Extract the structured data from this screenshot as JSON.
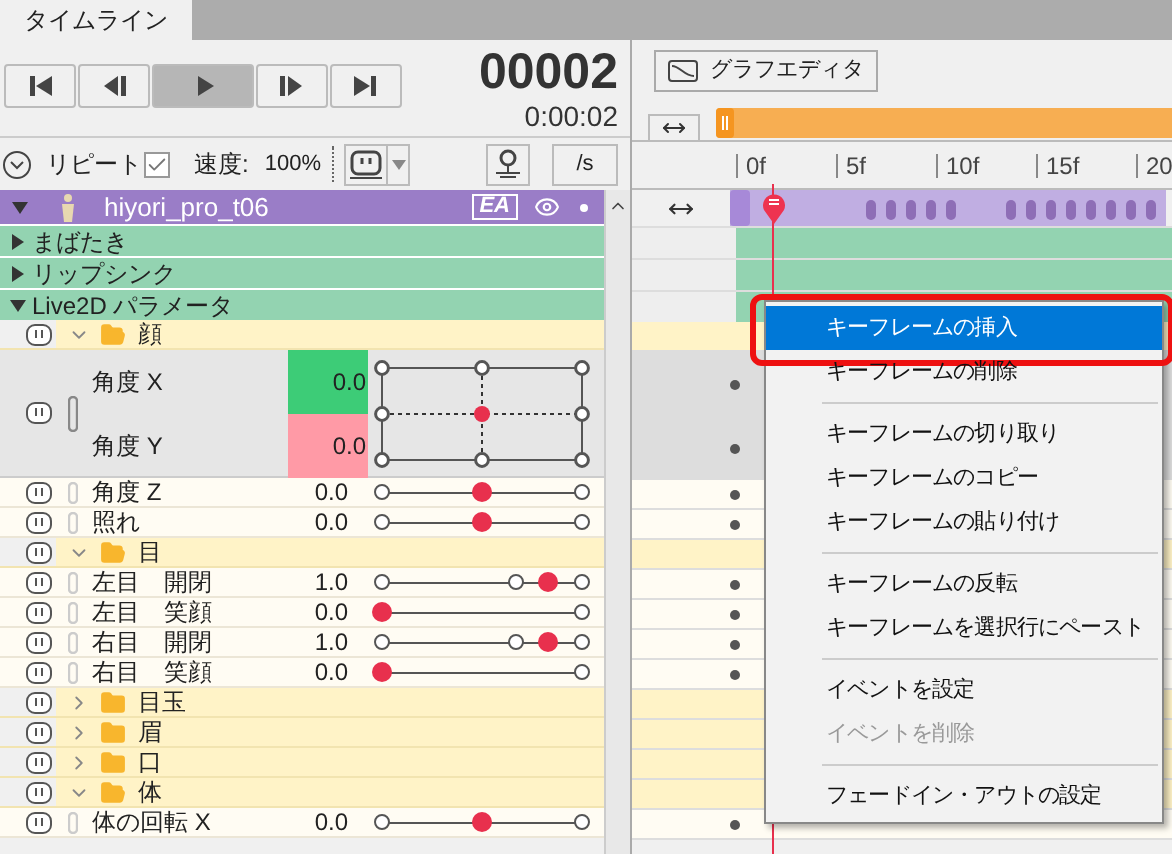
{
  "tabs": [
    {
      "label": "タイムライン",
      "selected": true
    }
  ],
  "transport": {
    "buttons": [
      {
        "kind": "first",
        "selected": false
      },
      {
        "kind": "prev",
        "selected": false
      },
      {
        "kind": "play",
        "selected": true
      },
      {
        "kind": "next",
        "selected": false
      },
      {
        "kind": "last",
        "selected": false
      }
    ],
    "frame": "00002",
    "time": "0:00:02"
  },
  "options": {
    "repeat": {
      "label": "リピート",
      "checked": true
    },
    "speed_label": "速度:",
    "speed": "100%",
    "fps_button": "/s"
  },
  "model": {
    "name": "hiyori_pro_t06",
    "badge": "EA",
    "expanded": true
  },
  "tracks": [
    {
      "label": "まばたき",
      "expanded": false
    },
    {
      "label": "リップシンク",
      "expanded": false
    },
    {
      "label": "Live2D パラメータ",
      "expanded": true
    }
  ],
  "parameters": [
    {
      "kind": "folder",
      "label": "顔",
      "expanded": true,
      "children": [
        {
          "kind": "group",
          "rows": [
            {
              "label": "角度 X",
              "value": "0.0",
              "color": "#3dcc77"
            },
            {
              "label": "角度 Y",
              "value": "0.0",
              "color": "#ff9aa6"
            }
          ]
        },
        {
          "kind": "centered",
          "label": "角度 Z",
          "value": "0.0",
          "level": 0.5
        },
        {
          "kind": "centered",
          "label": "照れ",
          "value": "0.0",
          "level": 0.5
        }
      ]
    },
    {
      "kind": "folder",
      "label": "目",
      "expanded": true,
      "children": [
        {
          "kind": "blink",
          "label": "左目　開閉",
          "value": "1.0",
          "level": 0.83
        },
        {
          "kind": "plain",
          "label": "左目　笑顔",
          "value": "0.0",
          "level": 0
        },
        {
          "kind": "blink",
          "label": "右目　開閉",
          "value": "1.0",
          "level": 0.83
        },
        {
          "kind": "plain",
          "label": "右目　笑顔",
          "value": "0.0",
          "level": 0
        }
      ]
    },
    {
      "kind": "folder",
      "label": "目玉",
      "expanded": false
    },
    {
      "kind": "folder",
      "label": "眉",
      "expanded": false
    },
    {
      "kind": "folder",
      "label": "口",
      "expanded": false
    },
    {
      "kind": "folder",
      "label": "体",
      "expanded": true,
      "children": [
        {
          "kind": "centered",
          "label": "体の回転 X",
          "value": "0.0",
          "level": 0.5
        }
      ]
    }
  ],
  "graph_editor": "グラフエディタ",
  "ruler": [
    "0f",
    "5f",
    "10f",
    "15f",
    "20"
  ],
  "context_menu": {
    "items": [
      {
        "kind": "item",
        "label": "キーフレームの挿入",
        "selected": true,
        "disabled": false
      },
      {
        "kind": "item",
        "label": "キーフレームの削除",
        "selected": false,
        "disabled": false
      },
      {
        "kind": "separator"
      },
      {
        "kind": "item",
        "label": "キーフレームの切り取り",
        "selected": false,
        "disabled": false
      },
      {
        "kind": "item",
        "label": "キーフレームのコピー",
        "selected": false,
        "disabled": false
      },
      {
        "kind": "item",
        "label": "キーフレームの貼り付け",
        "selected": false,
        "disabled": false
      },
      {
        "kind": "separator"
      },
      {
        "kind": "item",
        "label": "キーフレームの反転",
        "selected": false,
        "disabled": false
      },
      {
        "kind": "item",
        "label": "キーフレームを選択行にペースト",
        "selected": false,
        "disabled": false
      },
      {
        "kind": "separator"
      },
      {
        "kind": "item",
        "label": "イベントを設定",
        "selected": false,
        "disabled": false
      },
      {
        "kind": "item",
        "label": "イベントを削除",
        "selected": false,
        "disabled": true
      },
      {
        "kind": "separator"
      },
      {
        "kind": "item",
        "label": "フェードイン・アウトの設定",
        "selected": false,
        "disabled": false
      }
    ]
  }
}
